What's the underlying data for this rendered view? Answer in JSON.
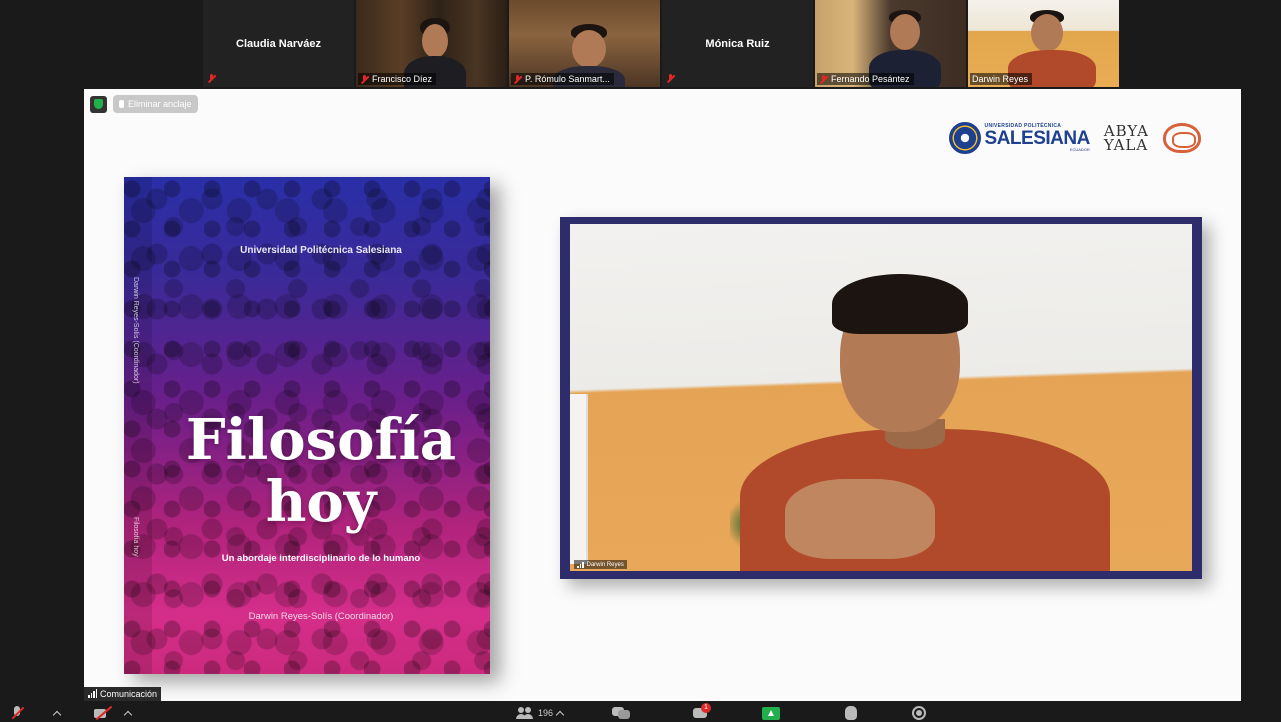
{
  "participants": [
    {
      "name": "Claudia Narváez",
      "video": false,
      "muted": true
    },
    {
      "name": "Francisco Díez",
      "video": true,
      "muted": true
    },
    {
      "name": "P. Rómulo Sanmart...",
      "video": true,
      "muted": true
    },
    {
      "name": "Mónica Ruiz",
      "video": false,
      "muted": true
    },
    {
      "name": "Fernando Pesántez",
      "video": true,
      "muted": true
    },
    {
      "name": "Darwin Reyes",
      "video": true,
      "muted": false
    }
  ],
  "share_bar": {
    "unpin_label": "Eliminar anclaje"
  },
  "logos": {
    "ups_small": "UNIVERSIDAD POLITÉCNICA",
    "ups_big": "SALESIANA",
    "ups_country": "ECUADOR",
    "abya_line1": "ABYA",
    "abya_line2": "YALA"
  },
  "book": {
    "university": "Universidad Politécnica Salesiana",
    "title_line1": "Filosofía",
    "title_line2": "hoy",
    "subtitle": "Un abordaje interdisciplinario de lo humano",
    "author": "Darwin Reyes-Solís (Coordinador)",
    "spine_author": "Darwin Reyes-Solís (Coordinador)",
    "spine_title": "Filosofía hoy"
  },
  "speaker": {
    "tag": "Darwin Reyes"
  },
  "connection": {
    "label": "Comunicación"
  },
  "toolbar": {
    "participants_count": "196",
    "chat_badge": "1"
  },
  "colors": {
    "accent_green": "#21b04b",
    "muted_red": "#e02828",
    "frame_navy": "#2e2c6a"
  },
  "icons": [
    "mic-off-icon",
    "camera-off-icon",
    "participants-icon",
    "qa-icon",
    "chat-icon",
    "share-screen-icon",
    "raise-hand-icon",
    "record-icon",
    "shield-icon",
    "pin-icon",
    "signal-icon"
  ]
}
